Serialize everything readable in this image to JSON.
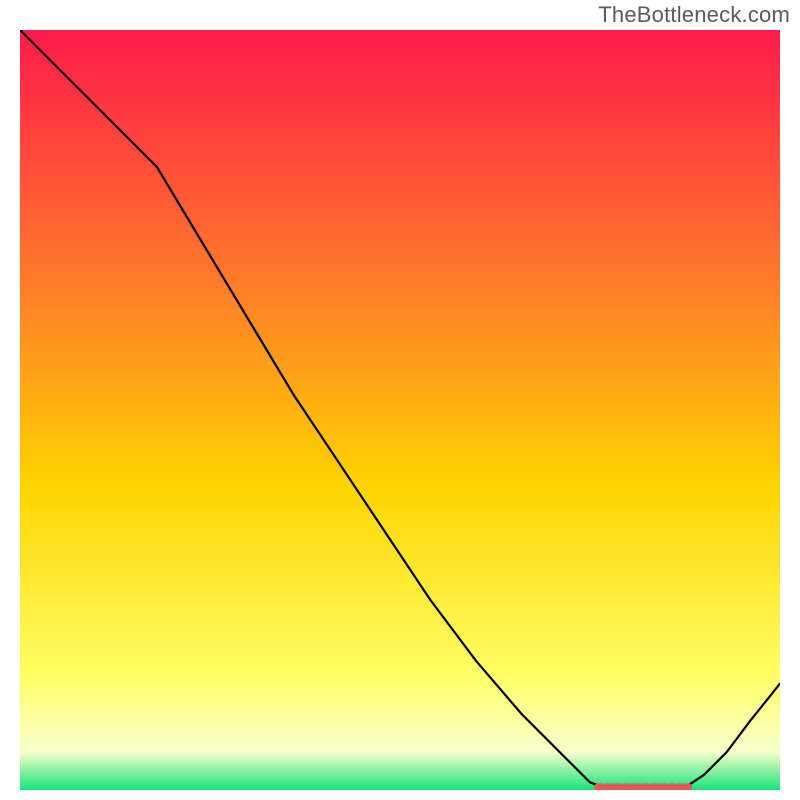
{
  "watermark": "TheBottleneck.com",
  "colors": {
    "gradient_top": "#ff1a4b",
    "gradient_mid1": "#ff7a2a",
    "gradient_mid2": "#ffd400",
    "gradient_low": "#ffff66",
    "gradient_pale": "#f7ffcc",
    "gradient_bottom": "#17e27a",
    "curve": "#000000",
    "marker": "#e05a5a"
  },
  "chart_data": {
    "type": "line",
    "title": "",
    "xlabel": "",
    "ylabel": "",
    "xlim": [
      0,
      100
    ],
    "ylim": [
      0,
      100
    ],
    "grid": false,
    "legend": false,
    "series": [
      {
        "name": "bottleneck-curve",
        "x": [
          0,
          6,
          12,
          18,
          24,
          30,
          36,
          42,
          48,
          54,
          60,
          66,
          72,
          75,
          78,
          81,
          84,
          87,
          90,
          93,
          96,
          100
        ],
        "y": [
          100,
          94,
          88,
          82,
          72,
          62,
          52,
          43,
          34,
          25,
          17,
          10,
          4,
          1,
          0,
          0,
          0,
          0,
          2,
          5,
          9,
          14
        ]
      }
    ],
    "marker": {
      "name": "optimal-range",
      "y": 0,
      "x_start": 76,
      "x_end": 88
    },
    "annotations": []
  }
}
